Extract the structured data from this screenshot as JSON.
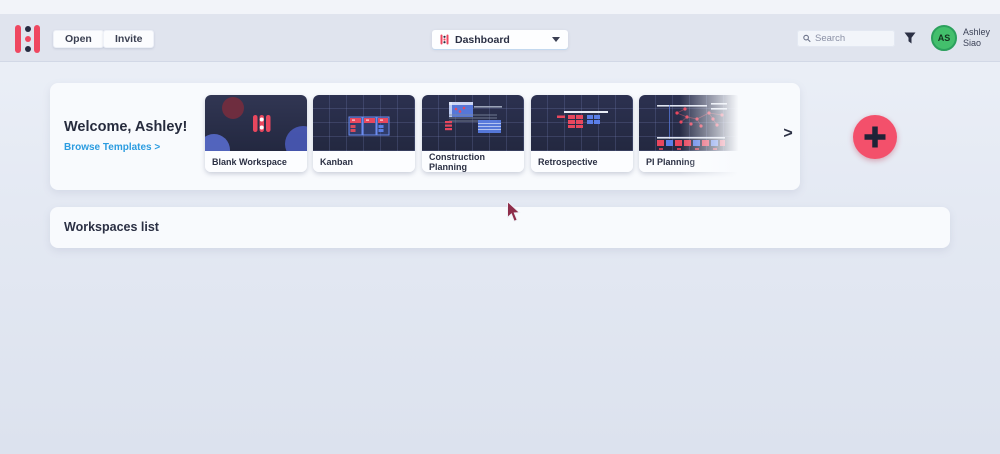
{
  "topbar": {
    "open_label": "Open",
    "invite_label": "Invite",
    "board_selector": {
      "value": "Dashboard"
    },
    "search": {
      "placeholder": "Search"
    },
    "user": {
      "initials": "AS",
      "first_name": "Ashley",
      "last_name": "Siao"
    }
  },
  "welcome": {
    "title": "Welcome, Ashley!",
    "browse_link": "Browse Templates >",
    "templates": [
      {
        "label": "Blank Workspace"
      },
      {
        "label": "Kanban"
      },
      {
        "label": "Construction Planning"
      },
      {
        "label": "Retrospective"
      },
      {
        "label": "PI Planning"
      }
    ],
    "next_arrow": ">"
  },
  "workspaces": {
    "title": "Workspaces list"
  },
  "colors": {
    "accent_red": "#ef4760",
    "plus_red": "#f3506b",
    "avatar_green": "#43bf6c",
    "link_blue": "#2b9ce0",
    "thumbnail_navy": "#262b45",
    "toolbar_gray": "#e0e4ee"
  }
}
